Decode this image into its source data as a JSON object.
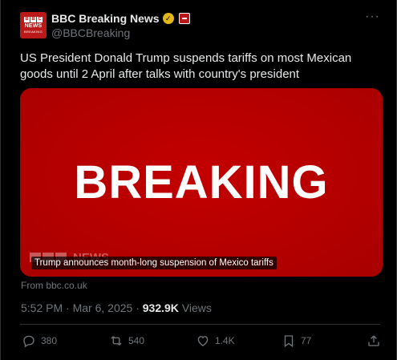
{
  "account": {
    "display_name": "BBC Breaking News",
    "handle": "@BBCBreaking",
    "avatar_logo": "BBC",
    "avatar_news": "NEWS",
    "avatar_sub": "BREAKING",
    "verified_color": "#e2b719",
    "brand_color": "#bb1919"
  },
  "tweet": {
    "text": "US President Donald Trump suspends tariffs on most Mexican goods until 2 April after talks with country's president",
    "media": {
      "headline": "BREAKING",
      "caption": "Trump announces month-long suspension of Mexico tariffs",
      "watermark": "NEWS"
    },
    "source": "From bbc.co.uk",
    "time": "5:52 PM",
    "date": "Mar 6, 2025",
    "separator": "·",
    "views_count": "932.9K",
    "views_label": "Views"
  },
  "actions": {
    "replies": "380",
    "reposts": "540",
    "likes": "1.4K",
    "bookmarks": "77"
  },
  "icons": {
    "more": "more-options-icon",
    "reply": "reply-icon",
    "repost": "repost-icon",
    "like": "heart-icon",
    "bookmark": "bookmark-icon",
    "share": "share-icon"
  }
}
